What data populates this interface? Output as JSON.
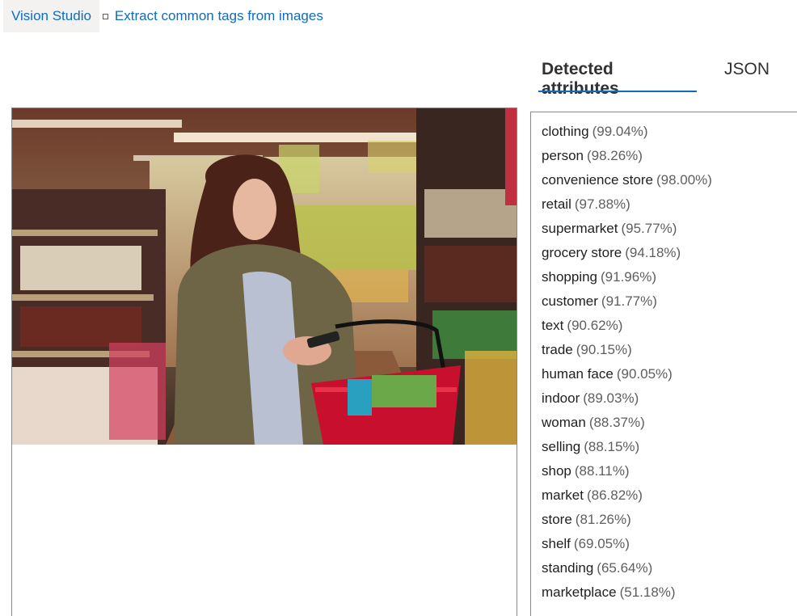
{
  "breadcrumb": {
    "home": "Vision Studio",
    "current": "Extract common tags from images"
  },
  "tabs": [
    {
      "label": "Detected attributes",
      "active": true
    },
    {
      "label": "JSON",
      "active": false
    }
  ],
  "tags": [
    {
      "name": "clothing",
      "confidence": "(99.04%)"
    },
    {
      "name": "person",
      "confidence": "(98.26%)"
    },
    {
      "name": "convenience store",
      "confidence": "(98.00%)"
    },
    {
      "name": "retail",
      "confidence": "(97.88%)"
    },
    {
      "name": "supermarket",
      "confidence": "(95.77%)"
    },
    {
      "name": "grocery store",
      "confidence": "(94.18%)"
    },
    {
      "name": "shopping",
      "confidence": "(91.96%)"
    },
    {
      "name": "customer",
      "confidence": "(91.77%)"
    },
    {
      "name": "text",
      "confidence": "(90.62%)"
    },
    {
      "name": "trade",
      "confidence": "(90.15%)"
    },
    {
      "name": "human face",
      "confidence": "(90.05%)"
    },
    {
      "name": "indoor",
      "confidence": "(89.03%)"
    },
    {
      "name": "woman",
      "confidence": "(88.37%)"
    },
    {
      "name": "selling",
      "confidence": "(88.15%)"
    },
    {
      "name": "shop",
      "confidence": "(88.11%)"
    },
    {
      "name": "market",
      "confidence": "(86.82%)"
    },
    {
      "name": "store",
      "confidence": "(81.26%)"
    },
    {
      "name": "shelf",
      "confidence": "(69.05%)"
    },
    {
      "name": "standing",
      "confidence": "(65.64%)"
    },
    {
      "name": "marketplace",
      "confidence": "(51.18%)"
    }
  ],
  "colors": {
    "link": "#0f6cbd",
    "tab_underline": "#0f6cbd",
    "basket": "#c8102e"
  }
}
